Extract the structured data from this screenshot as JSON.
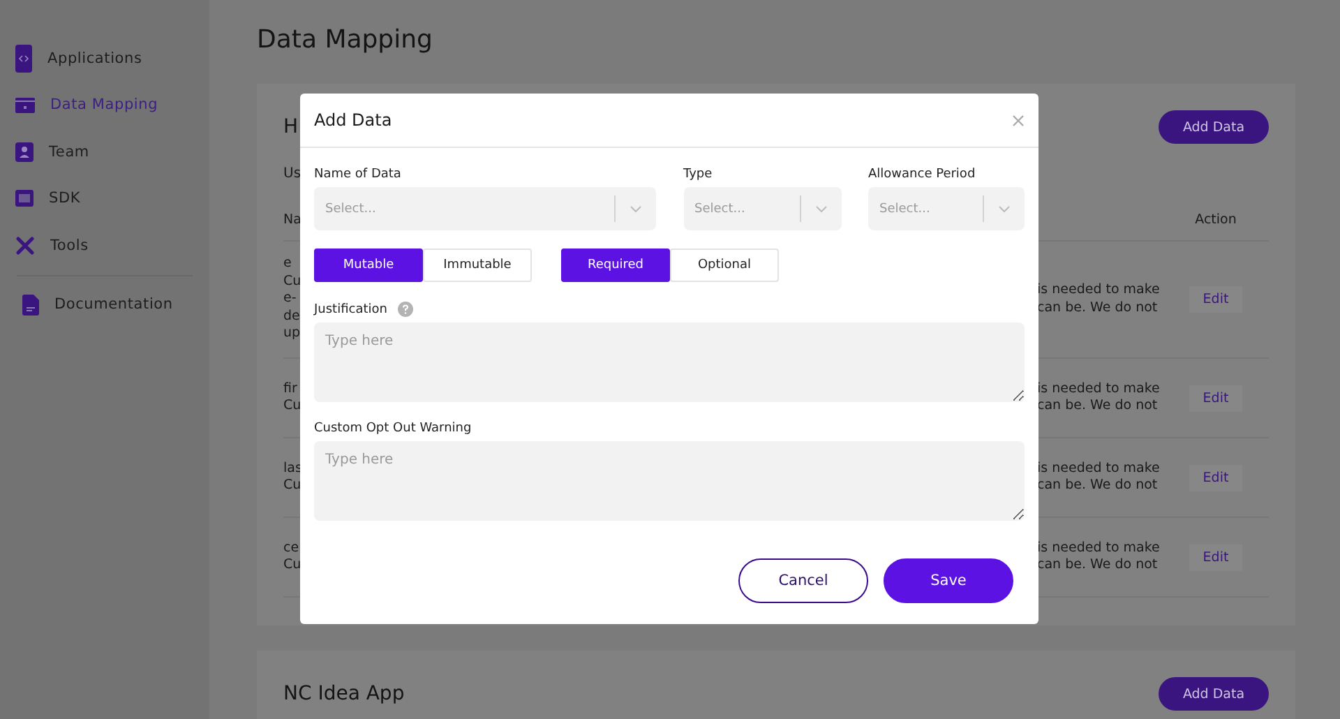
{
  "sidebar": {
    "items": [
      {
        "label": "Applications",
        "selected": false
      },
      {
        "label": "Data Mapping",
        "selected": true
      },
      {
        "label": "Team",
        "selected": false
      },
      {
        "label": "SDK",
        "selected": false
      },
      {
        "label": "Tools",
        "selected": false
      }
    ],
    "footer_items": [
      {
        "label": "Documentation",
        "selected": false
      }
    ]
  },
  "page": {
    "title": "Data Mapping"
  },
  "apps": [
    {
      "title": "H",
      "add_button": "Add Data",
      "subtitle": "Us",
      "columns": [
        "Na",
        "Action"
      ],
      "rows": [
        {
          "name_lines": [
            "e",
            "Cu",
            "e-",
            "de",
            "up"
          ],
          "description_lines": [
            "is needed to make",
            "can be. We do not"
          ],
          "action": "Edit"
        },
        {
          "name_lines": [
            "fir",
            "Cu"
          ],
          "description_lines": [
            "is needed to make",
            "can be. We do not"
          ],
          "action": "Edit"
        },
        {
          "name_lines": [
            "las",
            "Cu"
          ],
          "description_lines": [
            "is needed to make",
            "can be. We do not"
          ],
          "action": "Edit"
        },
        {
          "name_lines": [
            "ce",
            "Cu"
          ],
          "description_lines": [
            "is needed to make",
            "can be. We do not"
          ],
          "action": "Edit"
        }
      ]
    },
    {
      "title": "NC Idea App",
      "add_button": "Add Data"
    }
  ],
  "dialog": {
    "title": "Add Data",
    "selects": [
      {
        "label": "Name of Data",
        "placeholder": "Select..."
      },
      {
        "label": "Type",
        "placeholder": "Select..."
      },
      {
        "label": "Allowance Period",
        "placeholder": "Select..."
      }
    ],
    "toggles": [
      {
        "options": [
          {
            "label": "Mutable",
            "selected": true
          },
          {
            "label": "Immutable",
            "selected": false
          }
        ]
      },
      {
        "options": [
          {
            "label": "Required",
            "selected": true
          },
          {
            "label": "Optional",
            "selected": false
          }
        ]
      }
    ],
    "text_fields": [
      {
        "label": "Justification",
        "help": true,
        "placeholder": "Type here"
      },
      {
        "label": "Custom Opt Out Warning",
        "help": false,
        "placeholder": "Type here"
      }
    ],
    "buttons": [
      {
        "label": "Cancel",
        "kind": "secondary"
      },
      {
        "label": "Save",
        "kind": "primary"
      }
    ]
  }
}
